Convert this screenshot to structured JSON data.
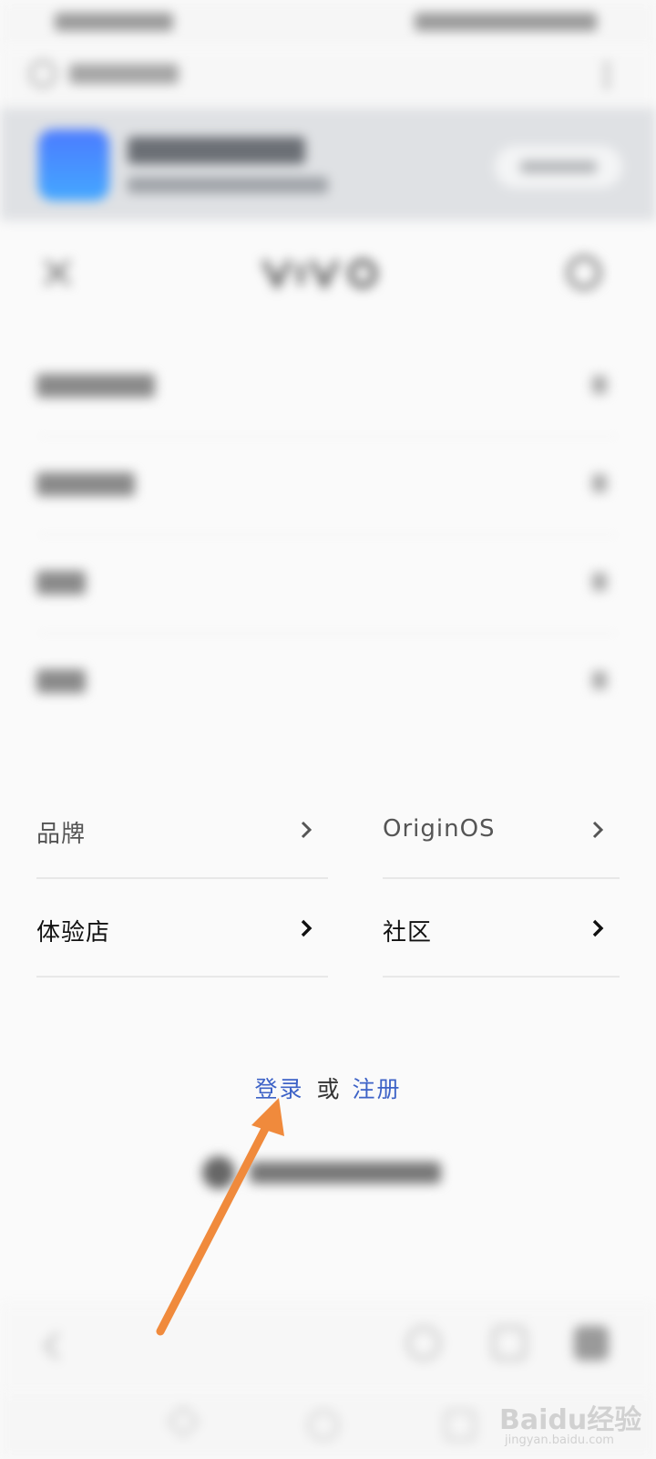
{
  "menu_grid": [
    {
      "label": "品牌",
      "style": "muted"
    },
    {
      "label": "OriginOS",
      "style": "muted"
    },
    {
      "label": "体验店",
      "style": "dark"
    },
    {
      "label": "社区",
      "style": "dark"
    }
  ],
  "auth": {
    "login": "登录",
    "or": "或",
    "register": "注册"
  },
  "watermark": {
    "text": "Baidu经验",
    "url": "jingyan.baidu.com"
  },
  "colors": {
    "link": "#3e63c7",
    "annotation_arrow": "#f08a3c",
    "app_logo": "#4b8dff"
  },
  "icons": {
    "close": "close-icon",
    "search": "search-icon",
    "chevron": "chevron-right-icon",
    "location": "location-icon"
  }
}
